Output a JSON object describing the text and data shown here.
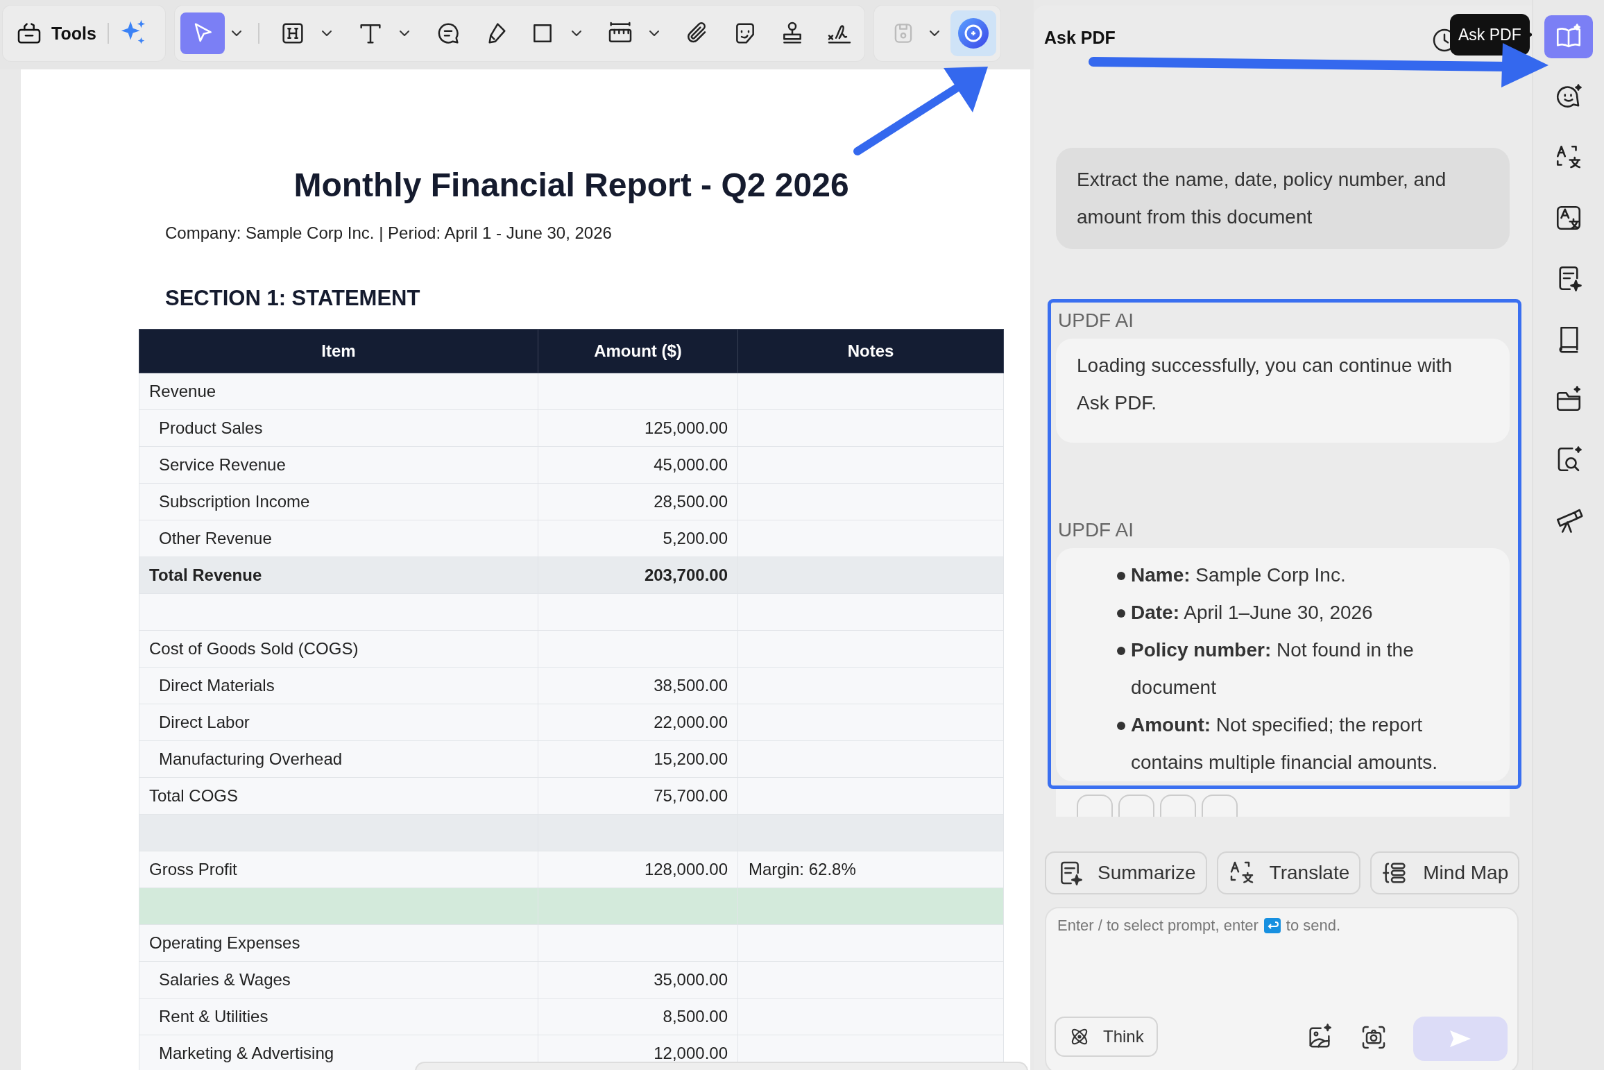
{
  "toolbar": {
    "tools_label": "Tools",
    "tools": [
      {
        "caret": true,
        "selected": true
      },
      {
        "caret": true,
        "selected": false
      },
      {
        "caret": true,
        "selected": false
      },
      {
        "caret": false,
        "selected": false
      },
      {
        "caret": false,
        "selected": false
      },
      {
        "caret": true,
        "selected": false
      },
      {
        "caret": true,
        "selected": false
      },
      {
        "caret": false,
        "selected": false
      },
      {
        "caret": false,
        "selected": false
      },
      {
        "caret": false,
        "selected": false
      },
      {
        "caret": false,
        "selected": false
      }
    ],
    "save": {
      "disabled": true,
      "caret": true
    },
    "ai": {
      "selected": true
    }
  },
  "document": {
    "title": "Monthly Financial Report - Q2 2026",
    "subtitle": "Company: Sample Corp Inc. | Period: April 1 - June 30, 2026",
    "section_title": "SECTION 1: STATEMENT",
    "table": {
      "columns": [
        "Item",
        "Amount ($)",
        "Notes"
      ],
      "rows": [
        {
          "kind": "section",
          "item": "Revenue"
        },
        {
          "kind": "item",
          "item": "Product Sales",
          "amount": "125,000.00"
        },
        {
          "kind": "item",
          "item": "Service Revenue",
          "amount": "45,000.00"
        },
        {
          "kind": "item",
          "item": "Subscription Income",
          "amount": "28,500.00"
        },
        {
          "kind": "item",
          "item": "Other Revenue",
          "amount": "5,200.00"
        },
        {
          "kind": "total",
          "item": "Total Revenue",
          "amount": "203,700.00"
        },
        {
          "kind": "gap"
        },
        {
          "kind": "section",
          "item": "Cost of Goods Sold (COGS)"
        },
        {
          "kind": "item",
          "item": "Direct Materials",
          "amount": "38,500.00"
        },
        {
          "kind": "item",
          "item": "Direct Labor",
          "amount": "22,000.00"
        },
        {
          "kind": "item",
          "item": "Manufacturing Overhead",
          "amount": "15,200.00"
        },
        {
          "kind": "section",
          "item": "Total COGS",
          "amount": "75,700.00"
        },
        {
          "kind": "band"
        },
        {
          "kind": "section",
          "item": "Gross Profit",
          "amount": "128,000.00",
          "notes": "Margin: 62.8%"
        },
        {
          "kind": "highlight"
        },
        {
          "kind": "section",
          "item": "Operating Expenses"
        },
        {
          "kind": "item",
          "item": "Salaries & Wages",
          "amount": "35,000.00"
        },
        {
          "kind": "item",
          "item": "Rent & Utilities",
          "amount": "8,500.00"
        },
        {
          "kind": "item",
          "item": "Marketing & Advertising",
          "amount": "12,000.00"
        }
      ]
    }
  },
  "panel": {
    "title": "Ask PDF",
    "tooltip": "Ask PDF",
    "highlight_box": true,
    "messages": [
      {
        "kind": "user",
        "text": "Extract the name, date, policy number, and amount from this document"
      },
      {
        "kind": "ai",
        "label": "UPDF AI",
        "text": "Loading successfully, you can continue with Ask PDF."
      },
      {
        "kind": "ai",
        "label": "UPDF AI",
        "items": [
          "**Name:** Sample Corp Inc.",
          "**Date:** April 1–June 30, 2026",
          "**Policy number:** Not found in the document",
          "**Amount:** Not specified; the report contains multiple financial amounts."
        ]
      }
    ],
    "quick_actions": [
      {
        "label": "Summarize"
      },
      {
        "label": "Translate"
      },
      {
        "label": "Mind Map"
      }
    ],
    "input": {
      "hint_before": "Enter / to select prompt, enter",
      "hint_after": "to send."
    },
    "think": "Think",
    "send": {
      "disabled": true
    }
  },
  "rail": {
    "items": [
      {
        "selected": true
      },
      {
        "selected": false
      },
      {
        "selected": false
      },
      {
        "selected": false
      },
      {
        "selected": false
      },
      {
        "selected": false
      },
      {
        "selected": false
      },
      {
        "selected": false
      },
      {
        "selected": false
      }
    ]
  }
}
